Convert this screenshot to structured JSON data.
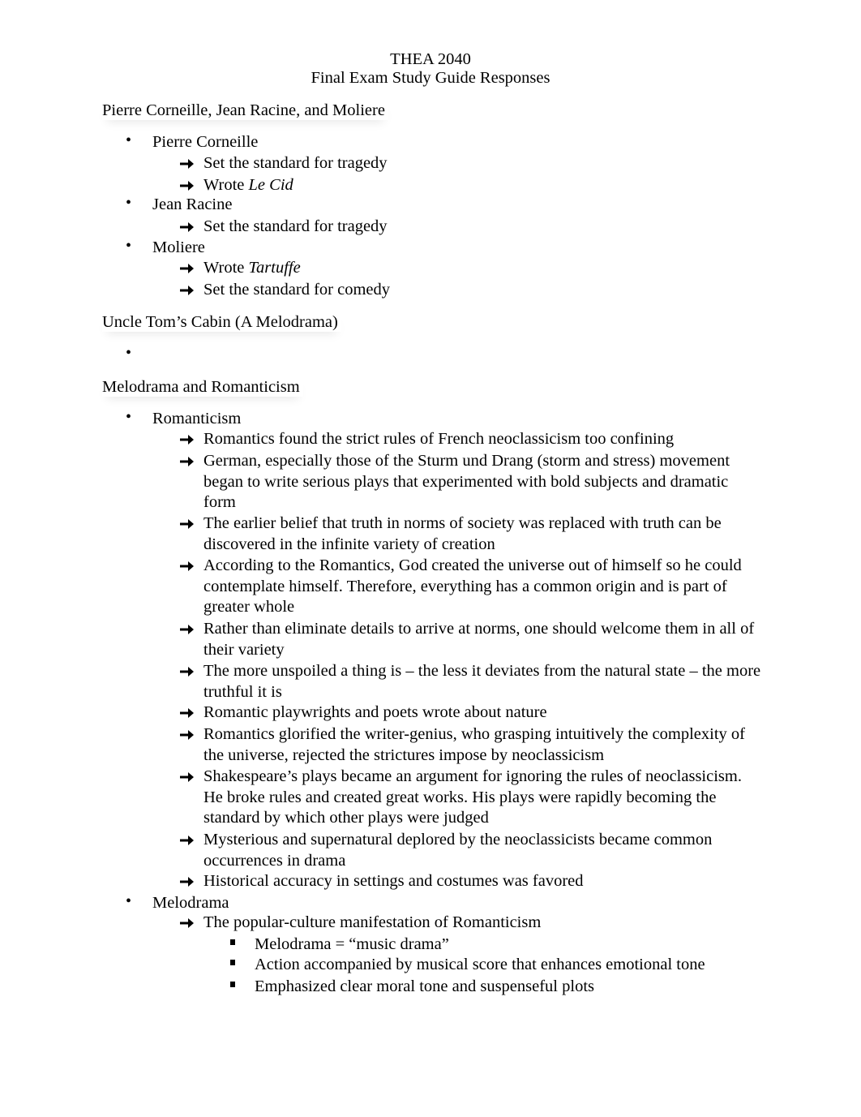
{
  "document": {
    "course": "THEA 2040",
    "subtitle": "Final Exam Study Guide Responses"
  },
  "sections": [
    {
      "heading": "Pierre Corneille, Jean Racine, and Moliere",
      "items": [
        {
          "label": "Pierre Corneille",
          "sub": [
            {
              "text": "Set the standard for tragedy"
            },
            {
              "text": "Wrote ",
              "italic": "Le Cid"
            }
          ]
        },
        {
          "label": "Jean Racine",
          "sub": [
            {
              "text": "Set the standard for tragedy"
            }
          ]
        },
        {
          "label": "Moliere",
          "sub": [
            {
              "text": "Wrote ",
              "italic": "Tartuffe"
            },
            {
              "text": "Set the standard for comedy"
            }
          ]
        }
      ]
    },
    {
      "heading": "Uncle Tom’s Cabin (A Melodrama)",
      "items": [
        {
          "label": ""
        }
      ]
    },
    {
      "heading": "Melodrama and Romanticism",
      "items": [
        {
          "label": "Romanticism",
          "sub": [
            {
              "text": "Romantics found the strict rules of French neoclassicism too confining"
            },
            {
              "text": "German, especially those of the Sturm und Drang (storm and stress) movement began to write serious plays that experimented with bold subjects and dramatic form"
            },
            {
              "text": "The earlier belief that truth in norms of society was replaced with truth can be discovered in the infinite variety of creation"
            },
            {
              "text": "According to the Romantics, God created the universe out of himself so he could contemplate himself. Therefore, everything has a common origin and is part of greater whole"
            },
            {
              "text": "Rather than eliminate details to arrive at norms, one should welcome them in all of their variety"
            },
            {
              "text": "The more unspoiled a thing is – the less it deviates from the natural state – the more truthful it is"
            },
            {
              "text": "Romantic playwrights and poets wrote about nature"
            },
            {
              "text": "Romantics glorified the writer-genius, who grasping intuitively the complexity of the universe, rejected the strictures impose by neoclassicism"
            },
            {
              "text": "Shakespeare’s plays became an argument for ignoring the rules of neoclassicism. He broke rules and created great works. His plays were rapidly becoming the standard by which other plays were judged"
            },
            {
              "text": "Mysterious and supernatural deplored by the neoclassicists became common occurrences in drama"
            },
            {
              "text": "Historical accuracy in settings and costumes was favored"
            }
          ]
        },
        {
          "label": "Melodrama",
          "sub": [
            {
              "text": "The popular-culture manifestation of Romanticism",
              "sub": [
                "Melodrama = “music drama”",
                "Action accompanied by musical score that enhances emotional tone",
                "Emphasized clear moral tone and suspenseful plots"
              ]
            }
          ]
        }
      ]
    }
  ]
}
